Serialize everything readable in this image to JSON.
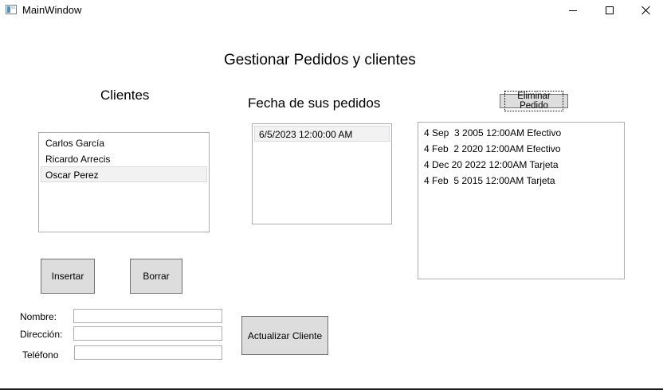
{
  "window": {
    "title": "MainWindow"
  },
  "page_title": "Gestionar Pedidos y clientes",
  "clientes": {
    "heading": "Clientes",
    "items": [
      "Carlos García",
      "Ricardo Arrecis",
      "Oscar Perez"
    ],
    "selected_index": 2
  },
  "pedidos_fechas": {
    "heading": "Fecha de sus pedidos",
    "items": [
      "6/5/2023 12:00:00 AM"
    ],
    "selected_index": 0
  },
  "pedidos": {
    "delete_label": "Eliminar Pedido",
    "items": [
      "4 Sep  3 2005 12:00AM Efectivo",
      "4 Feb  2 2020 12:00AM Efectivo",
      "4 Dec 20 2022 12:00AM Tarjeta",
      "4 Feb  5 2015 12:00AM Tarjeta"
    ]
  },
  "actions": {
    "insert_label": "Insertar",
    "delete_label": "Borrar",
    "update_label": "Actualizar Cliente"
  },
  "form": {
    "nombre_label": "Nombre:",
    "direccion_label": "Dirección:",
    "telefono_label": "Teléfono",
    "nombre_value": "",
    "direccion_value": "",
    "telefono_value": ""
  }
}
